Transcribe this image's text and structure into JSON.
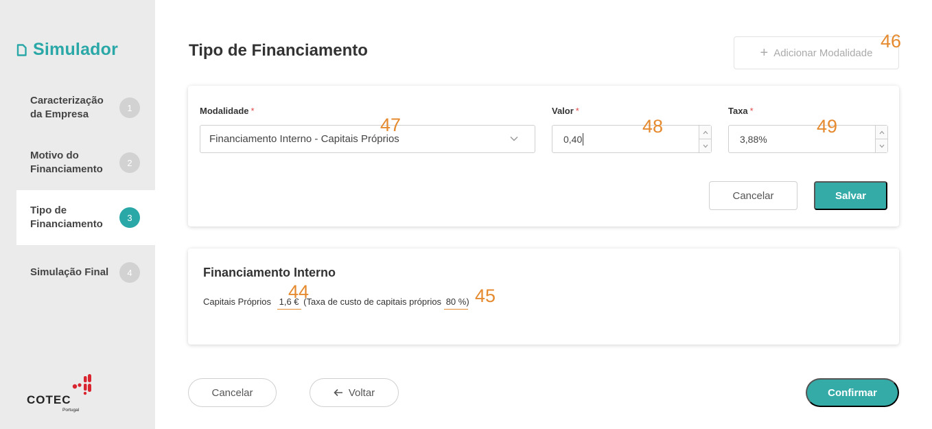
{
  "sidebar": {
    "brand_title": "Simulador",
    "brand_icon": "document-icon",
    "steps": [
      {
        "label": "Caracterização da Empresa",
        "number": "1",
        "active": false
      },
      {
        "label": "Motivo do Financiamento",
        "number": "2",
        "active": false
      },
      {
        "label": "Tipo de Financiamento",
        "number": "3",
        "active": true
      },
      {
        "label": "Simulação Final",
        "number": "4",
        "active": false
      }
    ],
    "logo": {
      "name": "COTEC",
      "sub": "Portugal"
    }
  },
  "header": {
    "title": "Tipo de Financiamento",
    "add_button": "Adicionar Modalidade"
  },
  "form": {
    "modalidade": {
      "label": "Modalidade",
      "required_mark": "*",
      "value": "Financiamento Interno - Capitais Próprios"
    },
    "valor": {
      "label": "Valor",
      "required_mark": "*",
      "value": "0,40"
    },
    "taxa": {
      "label": "Taxa",
      "required_mark": "*",
      "value": "3,88%"
    },
    "cancel_label": "Cancelar",
    "save_label": "Salvar"
  },
  "summary": {
    "title": "Financiamento Interno",
    "item_label": "Capitais Próprios",
    "item_value": "1,6 €",
    "rate_prefix": "(Taxa de custo de capitais próprios",
    "rate_value": "80 %",
    "rate_suffix": ")"
  },
  "footer": {
    "cancel_label": "Cancelar",
    "back_label": "Voltar",
    "confirm_label": "Confirmar"
  },
  "annotations": [
    "44",
    "45",
    "46",
    "47",
    "48",
    "49"
  ],
  "colors": {
    "accent": "#35aba8",
    "brand": "#2aa7a7",
    "annotation": "#e58a2e",
    "required": "#e04848",
    "logo_red": "#d9252f"
  }
}
